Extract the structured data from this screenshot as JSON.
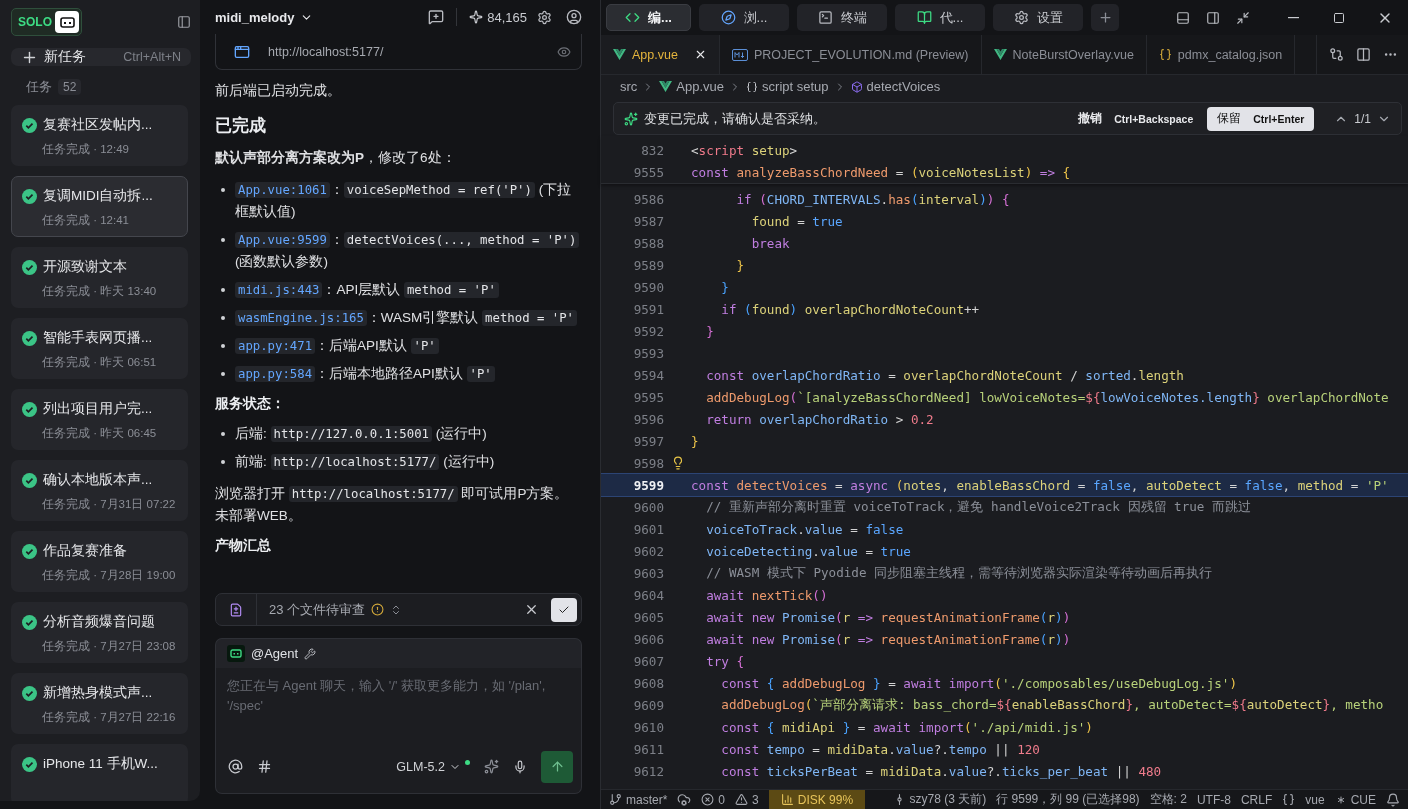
{
  "sidebar": {
    "logo": "SOLO",
    "new_task": {
      "label": "新任务",
      "shortcut": "Ctrl+Alt+N"
    },
    "tasks_header": {
      "label": "任务",
      "count": "52"
    },
    "tasks": [
      {
        "title": "复赛社区发帖内...",
        "status": "任务完成 · 12:49",
        "selected": false
      },
      {
        "title": "复调MIDI自动拆...",
        "status": "任务完成 · 12:41",
        "selected": true
      },
      {
        "title": "开源致谢文本",
        "status": "任务完成 · 昨天 13:40",
        "selected": false
      },
      {
        "title": "智能手表网页播...",
        "status": "任务完成 · 昨天 06:51",
        "selected": false
      },
      {
        "title": "列出项目用户完...",
        "status": "任务完成 · 昨天 06:45",
        "selected": false
      },
      {
        "title": "确认本地版本声...",
        "status": "任务完成 · 7月31日 07:22",
        "selected": false
      },
      {
        "title": "作品复赛准备",
        "status": "任务完成 · 7月28日 19:00",
        "selected": false
      },
      {
        "title": "分析音频爆音问题",
        "status": "任务完成 · 7月27日 23:08",
        "selected": false
      },
      {
        "title": "新增热身模式声...",
        "status": "任务完成 · 7月27日 22:16",
        "selected": false
      },
      {
        "title": "iPhone 11 手机W...",
        "selected": false
      }
    ]
  },
  "chat": {
    "project": "midi_melody",
    "credits": "84,165",
    "preview_url": "http://localhost:5177/",
    "blocks": [
      {
        "kind": "para",
        "segments": [
          {
            "kind": "text",
            "text": "前后端已启动完成。"
          }
        ]
      },
      {
        "kind": "heading",
        "text": "已完成"
      },
      {
        "kind": "para",
        "segments": [
          {
            "kind": "text",
            "text": "**默认声部分离方案改为P**，修改了6处："
          }
        ]
      },
      {
        "kind": "list",
        "items": [
          {
            "segments": [
              {
                "kind": "link",
                "text": "App.vue:1061"
              },
              {
                "kind": "text",
                "text": "："
              },
              {
                "kind": "code",
                "text": "voiceSepMethod = ref('P')"
              },
              {
                "kind": "text",
                "text": " (下拉框默认值)"
              }
            ]
          },
          {
            "segments": [
              {
                "kind": "link",
                "text": "App.vue:9599"
              },
              {
                "kind": "text",
                "text": "："
              },
              {
                "kind": "code",
                "text": "detectVoices(..., method = 'P')"
              },
              {
                "kind": "text",
                "text": " (函数默认参数)"
              }
            ]
          },
          {
            "segments": [
              {
                "kind": "link",
                "text": "midi.js:443"
              },
              {
                "kind": "text",
                "text": "：API层默认 "
              },
              {
                "kind": "code",
                "text": "method = 'P'"
              }
            ]
          },
          {
            "segments": [
              {
                "kind": "link",
                "text": "wasmEngine.js:165"
              },
              {
                "kind": "text",
                "text": "：WASM引擎默认 "
              },
              {
                "kind": "code",
                "text": "method = 'P'"
              }
            ]
          },
          {
            "segments": [
              {
                "kind": "link",
                "text": "app.py:471"
              },
              {
                "kind": "text",
                "text": "：后端API默认 "
              },
              {
                "kind": "code",
                "text": "'P'"
              }
            ]
          },
          {
            "segments": [
              {
                "kind": "link",
                "text": "app.py:584"
              },
              {
                "kind": "text",
                "text": "：后端本地路径API默认 "
              },
              {
                "kind": "code",
                "text": "'P'"
              }
            ]
          }
        ]
      },
      {
        "kind": "label",
        "text": "服务状态："
      },
      {
        "kind": "list",
        "items": [
          {
            "segments": [
              {
                "kind": "text",
                "text": "后端: "
              },
              {
                "kind": "code",
                "text": "http://127.0.0.1:5001"
              },
              {
                "kind": "text",
                "text": " (运行中)"
              }
            ]
          },
          {
            "segments": [
              {
                "kind": "text",
                "text": "前端: "
              },
              {
                "kind": "code",
                "text": "http://localhost:5177/"
              },
              {
                "kind": "text",
                "text": " (运行中)"
              }
            ]
          }
        ]
      },
      {
        "kind": "para",
        "segments": [
          {
            "kind": "text",
            "text": "浏览器打开 "
          },
          {
            "kind": "code",
            "text": "http://localhost:5177/"
          },
          {
            "kind": "text",
            "text": " 即可试用P方案。未部署WEB。"
          }
        ]
      },
      {
        "kind": "label",
        "text": "产物汇总"
      }
    ],
    "review": {
      "text": "23 个文件待审查"
    },
    "composer": {
      "agent": "@Agent",
      "placeholder": "您正在与 Agent 聊天，输入 '/' 获取更多能力，如 '/plan', '/spec'",
      "model": "GLM-5.2"
    }
  },
  "editor": {
    "modes": [
      {
        "label": "编...",
        "kind": "code",
        "selected": true
      },
      {
        "label": "浏...",
        "kind": "compass",
        "selected": false
      },
      {
        "label": "终端",
        "kind": "terminal",
        "selected": false
      },
      {
        "label": "代...",
        "kind": "book",
        "selected": false
      },
      {
        "label": "设置",
        "kind": "gear",
        "selected": false
      }
    ],
    "files": [
      {
        "name": "App.vue",
        "kind": "vue",
        "selected": true
      },
      {
        "name": "PROJECT_EVOLUTION.md (Preview)",
        "kind": "md",
        "selected": false
      },
      {
        "name": "NoteBurstOverlay.vue",
        "kind": "vue",
        "selected": false
      },
      {
        "name": "pdmx_catalog.json",
        "kind": "json",
        "selected": false
      }
    ],
    "breadcrumb": [
      {
        "text": "src",
        "kind": "folder"
      },
      {
        "text": "App.vue",
        "kind": "vue"
      },
      {
        "text": "script setup",
        "kind": "braces"
      },
      {
        "text": "detectVoices",
        "kind": "func"
      }
    ],
    "change_bar": {
      "message": "变更已完成，请确认是否采纳。",
      "undo": "撤销",
      "undo_keys": "Ctrl+Backspace",
      "keep": "保留",
      "keep_keys": "Ctrl+Enter",
      "counter": "1/1"
    },
    "sticky": [
      {
        "number": "832",
        "tokens": [
          {
            "kind": "plain",
            "text": "<"
          },
          {
            "kind": "red",
            "text": "script"
          },
          {
            "kind": "param",
            "text": " setup"
          },
          {
            "kind": "plain",
            "text": ">"
          }
        ]
      },
      {
        "number": "9555",
        "tokens": [
          {
            "kind": "keyword",
            "text": "const "
          },
          {
            "kind": "function",
            "text": "analyzeBassChordNeed"
          },
          {
            "kind": "plain",
            "text": " = "
          },
          {
            "kind": "brace1",
            "text": "("
          },
          {
            "kind": "param",
            "text": "voiceNotesList"
          },
          {
            "kind": "brace1",
            "text": ")"
          },
          {
            "kind": "keyword",
            "text": " => "
          },
          {
            "kind": "brace1",
            "text": "{"
          }
        ]
      }
    ],
    "lines": [
      {
        "number": "9586",
        "tokens": [
          {
            "kind": "keyword",
            "text": "      if "
          },
          {
            "kind": "brace2",
            "text": "("
          },
          {
            "kind": "variable",
            "text": "CHORD_INTERVALS"
          },
          {
            "kind": "plain",
            "text": "."
          },
          {
            "kind": "function",
            "text": "has"
          },
          {
            "kind": "brace3",
            "text": "("
          },
          {
            "kind": "param",
            "text": "interval"
          },
          {
            "kind": "brace3",
            "text": ")"
          },
          {
            "kind": "brace2",
            "text": ")"
          },
          {
            "kind": "brace2",
            "text": " {"
          }
        ]
      },
      {
        "number": "9587",
        "tokens": [
          {
            "kind": "param",
            "text": "        found"
          },
          {
            "kind": "plain",
            "text": " = "
          },
          {
            "kind": "bool",
            "text": "true"
          }
        ]
      },
      {
        "number": "9588",
        "tokens": [
          {
            "kind": "keyword",
            "text": "        break"
          }
        ]
      },
      {
        "number": "9589",
        "tokens": [
          {
            "kind": "brace1",
            "text": "      }"
          }
        ]
      },
      {
        "number": "9590",
        "tokens": [
          {
            "kind": "brace3",
            "text": "    }"
          }
        ]
      },
      {
        "number": "9591",
        "tokens": [
          {
            "kind": "keyword",
            "text": "    if "
          },
          {
            "kind": "brace3",
            "text": "("
          },
          {
            "kind": "param",
            "text": "found"
          },
          {
            "kind": "brace3",
            "text": ")"
          },
          {
            "kind": "param",
            "text": " overlapChordNoteCount"
          },
          {
            "kind": "plain",
            "text": "++"
          }
        ]
      },
      {
        "number": "9592",
        "tokens": [
          {
            "kind": "brace2",
            "text": "  }"
          }
        ]
      },
      {
        "number": "9593"
      },
      {
        "number": "9594",
        "tokens": [
          {
            "kind": "keyword",
            "text": "  const "
          },
          {
            "kind": "variable",
            "text": "overlapChordRatio"
          },
          {
            "kind": "plain",
            "text": " = "
          },
          {
            "kind": "param",
            "text": "overlapChordNoteCount"
          },
          {
            "kind": "plain",
            "text": " / "
          },
          {
            "kind": "variable",
            "text": "sorted"
          },
          {
            "kind": "plain",
            "text": "."
          },
          {
            "kind": "param",
            "text": "length"
          }
        ]
      },
      {
        "number": "9595",
        "tokens": [
          {
            "kind": "function",
            "text": "  addDebugLog"
          },
          {
            "kind": "brace2",
            "text": "("
          },
          {
            "kind": "string",
            "text": "`[analyzeBassChordNeed] lowVoiceNotes="
          },
          {
            "kind": "red",
            "text": "${"
          },
          {
            "kind": "variable",
            "text": "lowVoiceNotes.length"
          },
          {
            "kind": "red",
            "text": "}"
          },
          {
            "kind": "string",
            "text": " overlapChordNote"
          }
        ]
      },
      {
        "number": "9596",
        "tokens": [
          {
            "kind": "keyword",
            "text": "  return "
          },
          {
            "kind": "variable",
            "text": "overlapChordRatio"
          },
          {
            "kind": "plain",
            "text": " > "
          },
          {
            "kind": "number",
            "text": "0.2"
          }
        ]
      },
      {
        "number": "9597",
        "tokens": [
          {
            "kind": "brace1",
            "text": "}"
          }
        ]
      },
      {
        "number": "9598",
        "bulb": true
      },
      {
        "number": "9599",
        "current": true,
        "tokens": [
          {
            "kind": "keyword",
            "text": "const "
          },
          {
            "kind": "function",
            "text": "detectVoices"
          },
          {
            "kind": "plain",
            "text": " = "
          },
          {
            "kind": "keyword",
            "text": "async "
          },
          {
            "kind": "brace1",
            "text": "("
          },
          {
            "kind": "param",
            "text": "notes"
          },
          {
            "kind": "plain",
            "text": ", "
          },
          {
            "kind": "param",
            "text": "enableBassChord"
          },
          {
            "kind": "plain",
            "text": " = "
          },
          {
            "kind": "bool",
            "text": "false"
          },
          {
            "kind": "plain",
            "text": ", "
          },
          {
            "kind": "param",
            "text": "autoDetect"
          },
          {
            "kind": "plain",
            "text": " = "
          },
          {
            "kind": "bool",
            "text": "false"
          },
          {
            "kind": "plain",
            "text": ", "
          },
          {
            "kind": "param",
            "text": "method"
          },
          {
            "kind": "plain",
            "text": " = "
          },
          {
            "kind": "string",
            "text": "'P'"
          }
        ]
      },
      {
        "number": "9600",
        "tokens": [
          {
            "kind": "comment",
            "text": "  // 重新声部分离时重置 voiceToTrack，避免 handleVoice2Track 因残留 true 而跳过"
          }
        ]
      },
      {
        "number": "9601",
        "tokens": [
          {
            "kind": "variable",
            "text": "  voiceToTrack"
          },
          {
            "kind": "plain",
            "text": "."
          },
          {
            "kind": "variable",
            "text": "value"
          },
          {
            "kind": "plain",
            "text": " = "
          },
          {
            "kind": "bool",
            "text": "false"
          }
        ]
      },
      {
        "number": "9602",
        "tokens": [
          {
            "kind": "variable",
            "text": "  voiceDetecting"
          },
          {
            "kind": "plain",
            "text": "."
          },
          {
            "kind": "variable",
            "text": "value"
          },
          {
            "kind": "plain",
            "text": " = "
          },
          {
            "kind": "bool",
            "text": "true"
          }
        ]
      },
      {
        "number": "9603",
        "tokens": [
          {
            "kind": "comment",
            "text": "  // WASM 模式下 Pyodide 同步阻塞主线程，需等待浏览器实际渲染等待动画后再执行"
          }
        ]
      },
      {
        "number": "9604",
        "tokens": [
          {
            "kind": "keyword",
            "text": "  await "
          },
          {
            "kind": "function",
            "text": "nextTick"
          },
          {
            "kind": "brace2",
            "text": "()"
          }
        ]
      },
      {
        "number": "9605",
        "tokens": [
          {
            "kind": "keyword",
            "text": "  await new "
          },
          {
            "kind": "variable",
            "text": "Promise"
          },
          {
            "kind": "brace2",
            "text": "("
          },
          {
            "kind": "param",
            "text": "r"
          },
          {
            "kind": "keyword",
            "text": " => "
          },
          {
            "kind": "function",
            "text": "requestAnimationFrame"
          },
          {
            "kind": "brace3",
            "text": "("
          },
          {
            "kind": "param",
            "text": "r"
          },
          {
            "kind": "brace3",
            "text": ")"
          },
          {
            "kind": "brace2",
            "text": ")"
          }
        ]
      },
      {
        "number": "9606",
        "tokens": [
          {
            "kind": "keyword",
            "text": "  await new "
          },
          {
            "kind": "variable",
            "text": "Promise"
          },
          {
            "kind": "brace2",
            "text": "("
          },
          {
            "kind": "param",
            "text": "r"
          },
          {
            "kind": "keyword",
            "text": " => "
          },
          {
            "kind": "function",
            "text": "requestAnimationFrame"
          },
          {
            "kind": "brace3",
            "text": "("
          },
          {
            "kind": "param",
            "text": "r"
          },
          {
            "kind": "brace3",
            "text": ")"
          },
          {
            "kind": "brace2",
            "text": ")"
          }
        ]
      },
      {
        "number": "9607",
        "tokens": [
          {
            "kind": "keyword",
            "text": "  try "
          },
          {
            "kind": "brace2",
            "text": "{"
          }
        ]
      },
      {
        "number": "9608",
        "tokens": [
          {
            "kind": "keyword",
            "text": "    const "
          },
          {
            "kind": "brace3",
            "text": "{ "
          },
          {
            "kind": "function",
            "text": "addDebugLog"
          },
          {
            "kind": "brace3",
            "text": " }"
          },
          {
            "kind": "plain",
            "text": " = "
          },
          {
            "kind": "keyword",
            "text": "await import"
          },
          {
            "kind": "brace1",
            "text": "("
          },
          {
            "kind": "string",
            "text": "'./composables/useDebugLog.js'"
          },
          {
            "kind": "brace1",
            "text": ")"
          }
        ]
      },
      {
        "number": "9609",
        "tokens": [
          {
            "kind": "function",
            "text": "    addDebugLog"
          },
          {
            "kind": "brace1",
            "text": "("
          },
          {
            "kind": "string",
            "text": "`声部分离请求: bass_chord="
          },
          {
            "kind": "red",
            "text": "${"
          },
          {
            "kind": "param",
            "text": "enableBassChord"
          },
          {
            "kind": "red",
            "text": "}"
          },
          {
            "kind": "string",
            "text": ", autoDetect="
          },
          {
            "kind": "red",
            "text": "${"
          },
          {
            "kind": "param",
            "text": "autoDetect"
          },
          {
            "kind": "red",
            "text": "}"
          },
          {
            "kind": "string",
            "text": ", metho"
          }
        ]
      },
      {
        "number": "9610",
        "tokens": [
          {
            "kind": "keyword",
            "text": "    const "
          },
          {
            "kind": "brace3",
            "text": "{ "
          },
          {
            "kind": "param",
            "text": "midiApi"
          },
          {
            "kind": "brace3",
            "text": " }"
          },
          {
            "kind": "plain",
            "text": " = "
          },
          {
            "kind": "keyword",
            "text": "await import"
          },
          {
            "kind": "brace1",
            "text": "("
          },
          {
            "kind": "string",
            "text": "'./api/midi.js'"
          },
          {
            "kind": "brace1",
            "text": ")"
          }
        ]
      },
      {
        "number": "9611",
        "tokens": [
          {
            "kind": "keyword",
            "text": "    const "
          },
          {
            "kind": "variable",
            "text": "tempo"
          },
          {
            "kind": "plain",
            "text": " = "
          },
          {
            "kind": "param",
            "text": "midiData"
          },
          {
            "kind": "plain",
            "text": "."
          },
          {
            "kind": "variable",
            "text": "value"
          },
          {
            "kind": "plain",
            "text": "?."
          },
          {
            "kind": "variable",
            "text": "tempo"
          },
          {
            "kind": "plain",
            "text": " || "
          },
          {
            "kind": "number",
            "text": "120"
          }
        ]
      },
      {
        "number": "9612",
        "tokens": [
          {
            "kind": "keyword",
            "text": "    const "
          },
          {
            "kind": "variable",
            "text": "ticksPerBeat"
          },
          {
            "kind": "plain",
            "text": " = "
          },
          {
            "kind": "param",
            "text": "midiData"
          },
          {
            "kind": "plain",
            "text": "."
          },
          {
            "kind": "variable",
            "text": "value"
          },
          {
            "kind": "plain",
            "text": "?."
          },
          {
            "kind": "variable",
            "text": "ticks_per_beat"
          },
          {
            "kind": "plain",
            "text": " || "
          },
          {
            "kind": "number",
            "text": "480"
          }
        ]
      }
    ]
  },
  "status_bar": {
    "left": [
      {
        "kind": "branch",
        "text": "master*"
      },
      {
        "kind": "sync"
      },
      {
        "kind": "errors",
        "text": "0"
      },
      {
        "kind": "warnings",
        "text": "3"
      },
      {
        "kind": "disk",
        "text": "DISK 99%"
      }
    ],
    "right": [
      {
        "kind": "blame",
        "text": "szy78 (3 天前)"
      },
      {
        "kind": "plain",
        "text": "行 9599，列 99 (已选择98)"
      },
      {
        "kind": "plain",
        "text": "空格: 2"
      },
      {
        "kind": "plain",
        "text": "UTF-8"
      },
      {
        "kind": "plain",
        "text": "CRLF"
      },
      {
        "kind": "braces"
      },
      {
        "kind": "plain",
        "text": "vue"
      },
      {
        "kind": "cue",
        "text": "CUE"
      },
      {
        "kind": "bell"
      }
    ]
  }
}
